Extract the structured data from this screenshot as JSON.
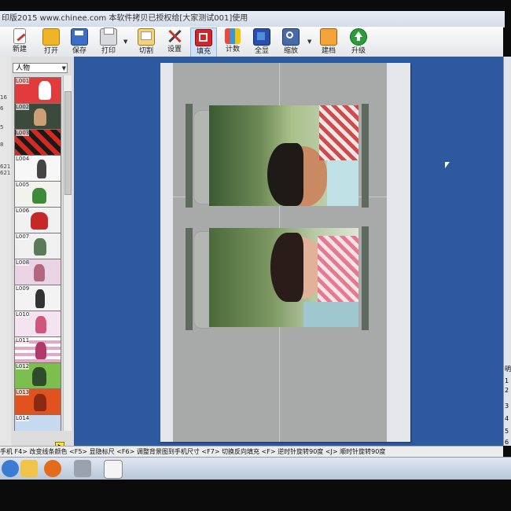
{
  "window": {
    "title": "印版2015 www.chinee.com   本软件拷贝已授权给[大家测试001]使用"
  },
  "toolbar": {
    "buttons": [
      {
        "label": "新建",
        "icon": "new-document-icon"
      },
      {
        "label": "打开",
        "icon": "folder-open-icon"
      },
      {
        "label": "保存",
        "icon": "floppy-save-icon"
      },
      {
        "label": "打印",
        "icon": "printer-icon"
      },
      {
        "label": "切割",
        "icon": "cutter-icon"
      },
      {
        "label": "设置",
        "icon": "tools-icon"
      },
      {
        "label": "填充",
        "icon": "fill-icon"
      },
      {
        "label": "计数",
        "icon": "counter-icon"
      },
      {
        "label": "全显",
        "icon": "fit-screen-icon"
      },
      {
        "label": "缩放",
        "icon": "zoom-icon"
      },
      {
        "label": "建档",
        "icon": "archive-folder-icon"
      },
      {
        "label": "升级",
        "icon": "upgrade-arrow-icon"
      }
    ],
    "active": "填充"
  },
  "left_strip": {
    "numbers": [
      "16",
      "6",
      "5",
      "8",
      "621",
      "621"
    ]
  },
  "thumbnail_panel": {
    "category": "人物",
    "items": [
      "L001",
      "L002",
      "L003",
      "L004",
      "L005",
      "L006",
      "L007",
      "L008",
      "L009",
      "L010",
      "L011",
      "L012",
      "L013",
      "L014"
    ]
  },
  "right_panel": {
    "chars": [
      "明",
      "1",
      "2",
      "3",
      "4",
      "5",
      "6"
    ]
  },
  "status_bar": {
    "text": "手机 F4> 改变线条颜色 <F5> 显隐标尺  <F6> 调整背景图到手机尺寸  <F7> 切换反向填充  <F> 逆时针旋转90度  <J> 顺时针旋转90度"
  },
  "colors": {
    "workspace": "#2d5a9e",
    "accent_green": "#2a9d3a",
    "accent_red": "#d3242a"
  }
}
